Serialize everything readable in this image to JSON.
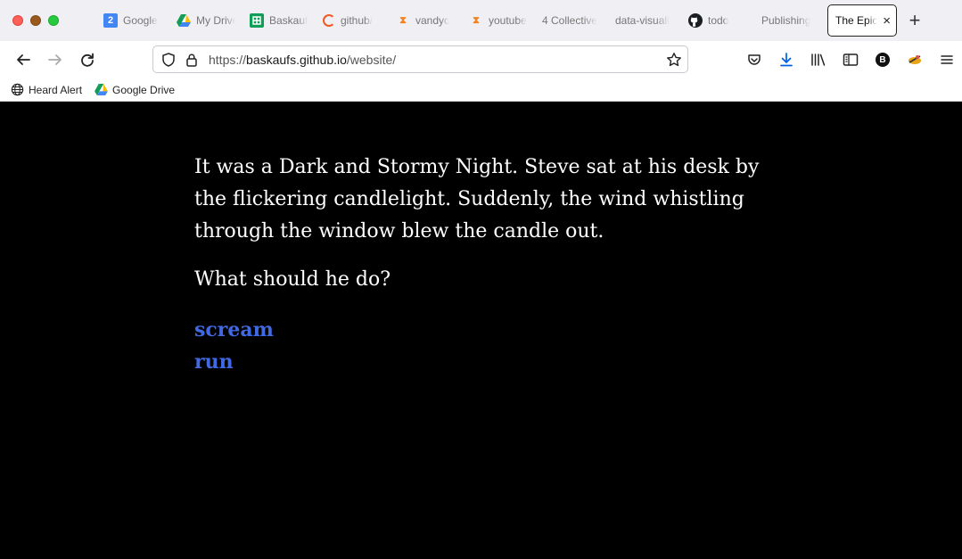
{
  "browser": {
    "tabs": [
      {
        "label": "Google",
        "icon": "calendar-icon"
      },
      {
        "label": "My Drive",
        "icon": "google-drive-icon"
      },
      {
        "label": "Baskauf",
        "icon": "sheets-icon"
      },
      {
        "label": "github/",
        "icon": "arc-icon"
      },
      {
        "label": "vandyc",
        "icon": "hourglass-icon"
      },
      {
        "label": "youtube",
        "icon": "hourglass-icon"
      },
      {
        "label": "4 Collective",
        "icon": ""
      },
      {
        "label": "data-visuali",
        "icon": ""
      },
      {
        "label": "todo",
        "icon": "github-icon"
      },
      {
        "label": "Publishing",
        "icon": ""
      }
    ],
    "active_tab": {
      "label": "The Epic",
      "close": "×"
    },
    "new_tab": "+",
    "calendar_day": "2",
    "url_prefix": "https://",
    "url_host": "baskaufs.github.io",
    "url_path": "/website/",
    "avatar_letter": "B",
    "bookmarks": [
      {
        "label": "Heard Alert",
        "icon": "globe-icon"
      },
      {
        "label": "Google Drive",
        "icon": "google-drive-icon"
      }
    ]
  },
  "page": {
    "story": "It was a Dark and Stormy Night. Steve sat at his desk by the flickering candlelight. Suddenly, the wind whistling through the window blew the candle out.",
    "question": "What should he do?",
    "choices": [
      "scream",
      "run"
    ],
    "colors": {
      "background": "#000000",
      "text": "#ffffff",
      "link": "#4169e1"
    }
  }
}
